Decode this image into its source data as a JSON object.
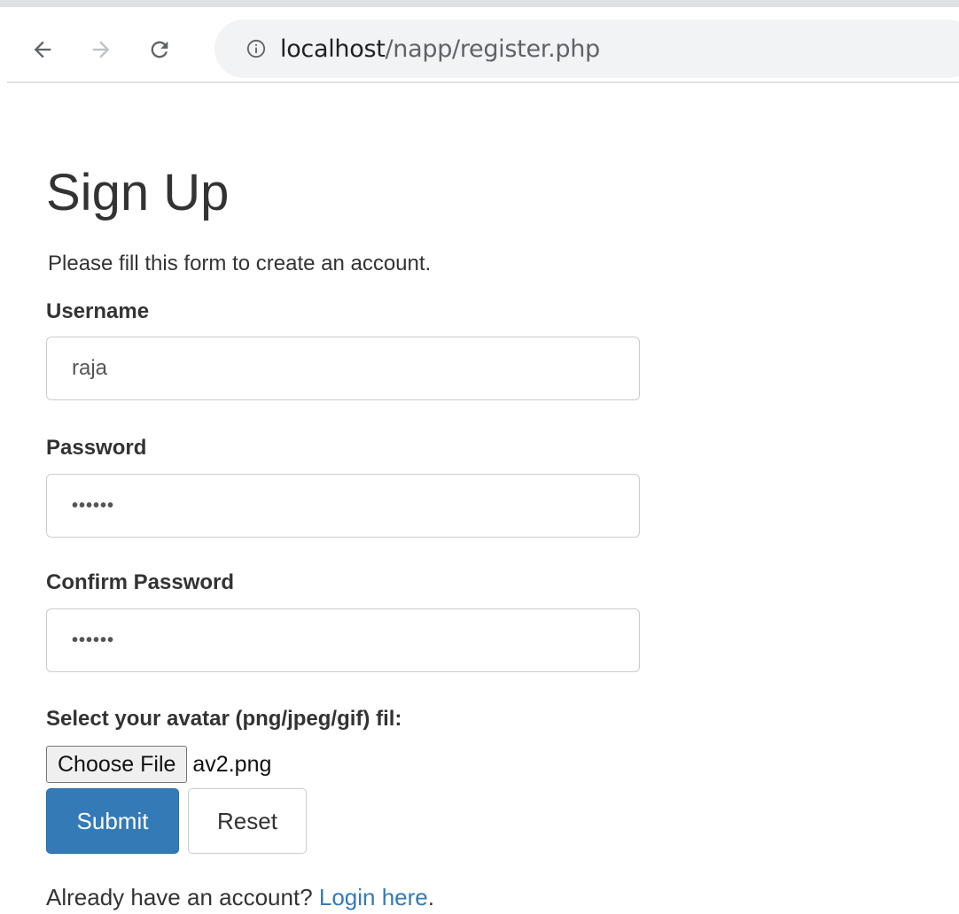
{
  "browser": {
    "url_host": "localhost",
    "url_path": "/napp/register.php",
    "icons": {
      "back": "arrow-left-icon",
      "forward": "arrow-right-icon",
      "reload": "reload-icon",
      "info": "info-icon"
    }
  },
  "form": {
    "title": "Sign Up",
    "subtitle": "Please fill this form to create an account.",
    "username": {
      "label": "Username",
      "value": "raja"
    },
    "password": {
      "label": "Password",
      "value": "••••••"
    },
    "confirm_password": {
      "label": "Confirm Password",
      "value": "••••••"
    },
    "avatar": {
      "label": "Select your avatar (png/jpeg/gif) fil:",
      "button_label": "Choose File",
      "file_name": "av2.png"
    },
    "submit_label": "Submit",
    "reset_label": "Reset",
    "footer_text": "Already have an account? ",
    "login_link": "Login here",
    "footer_end": "."
  },
  "colors": {
    "primary": "#337ab7",
    "text": "#333333",
    "border": "#cccccc"
  }
}
